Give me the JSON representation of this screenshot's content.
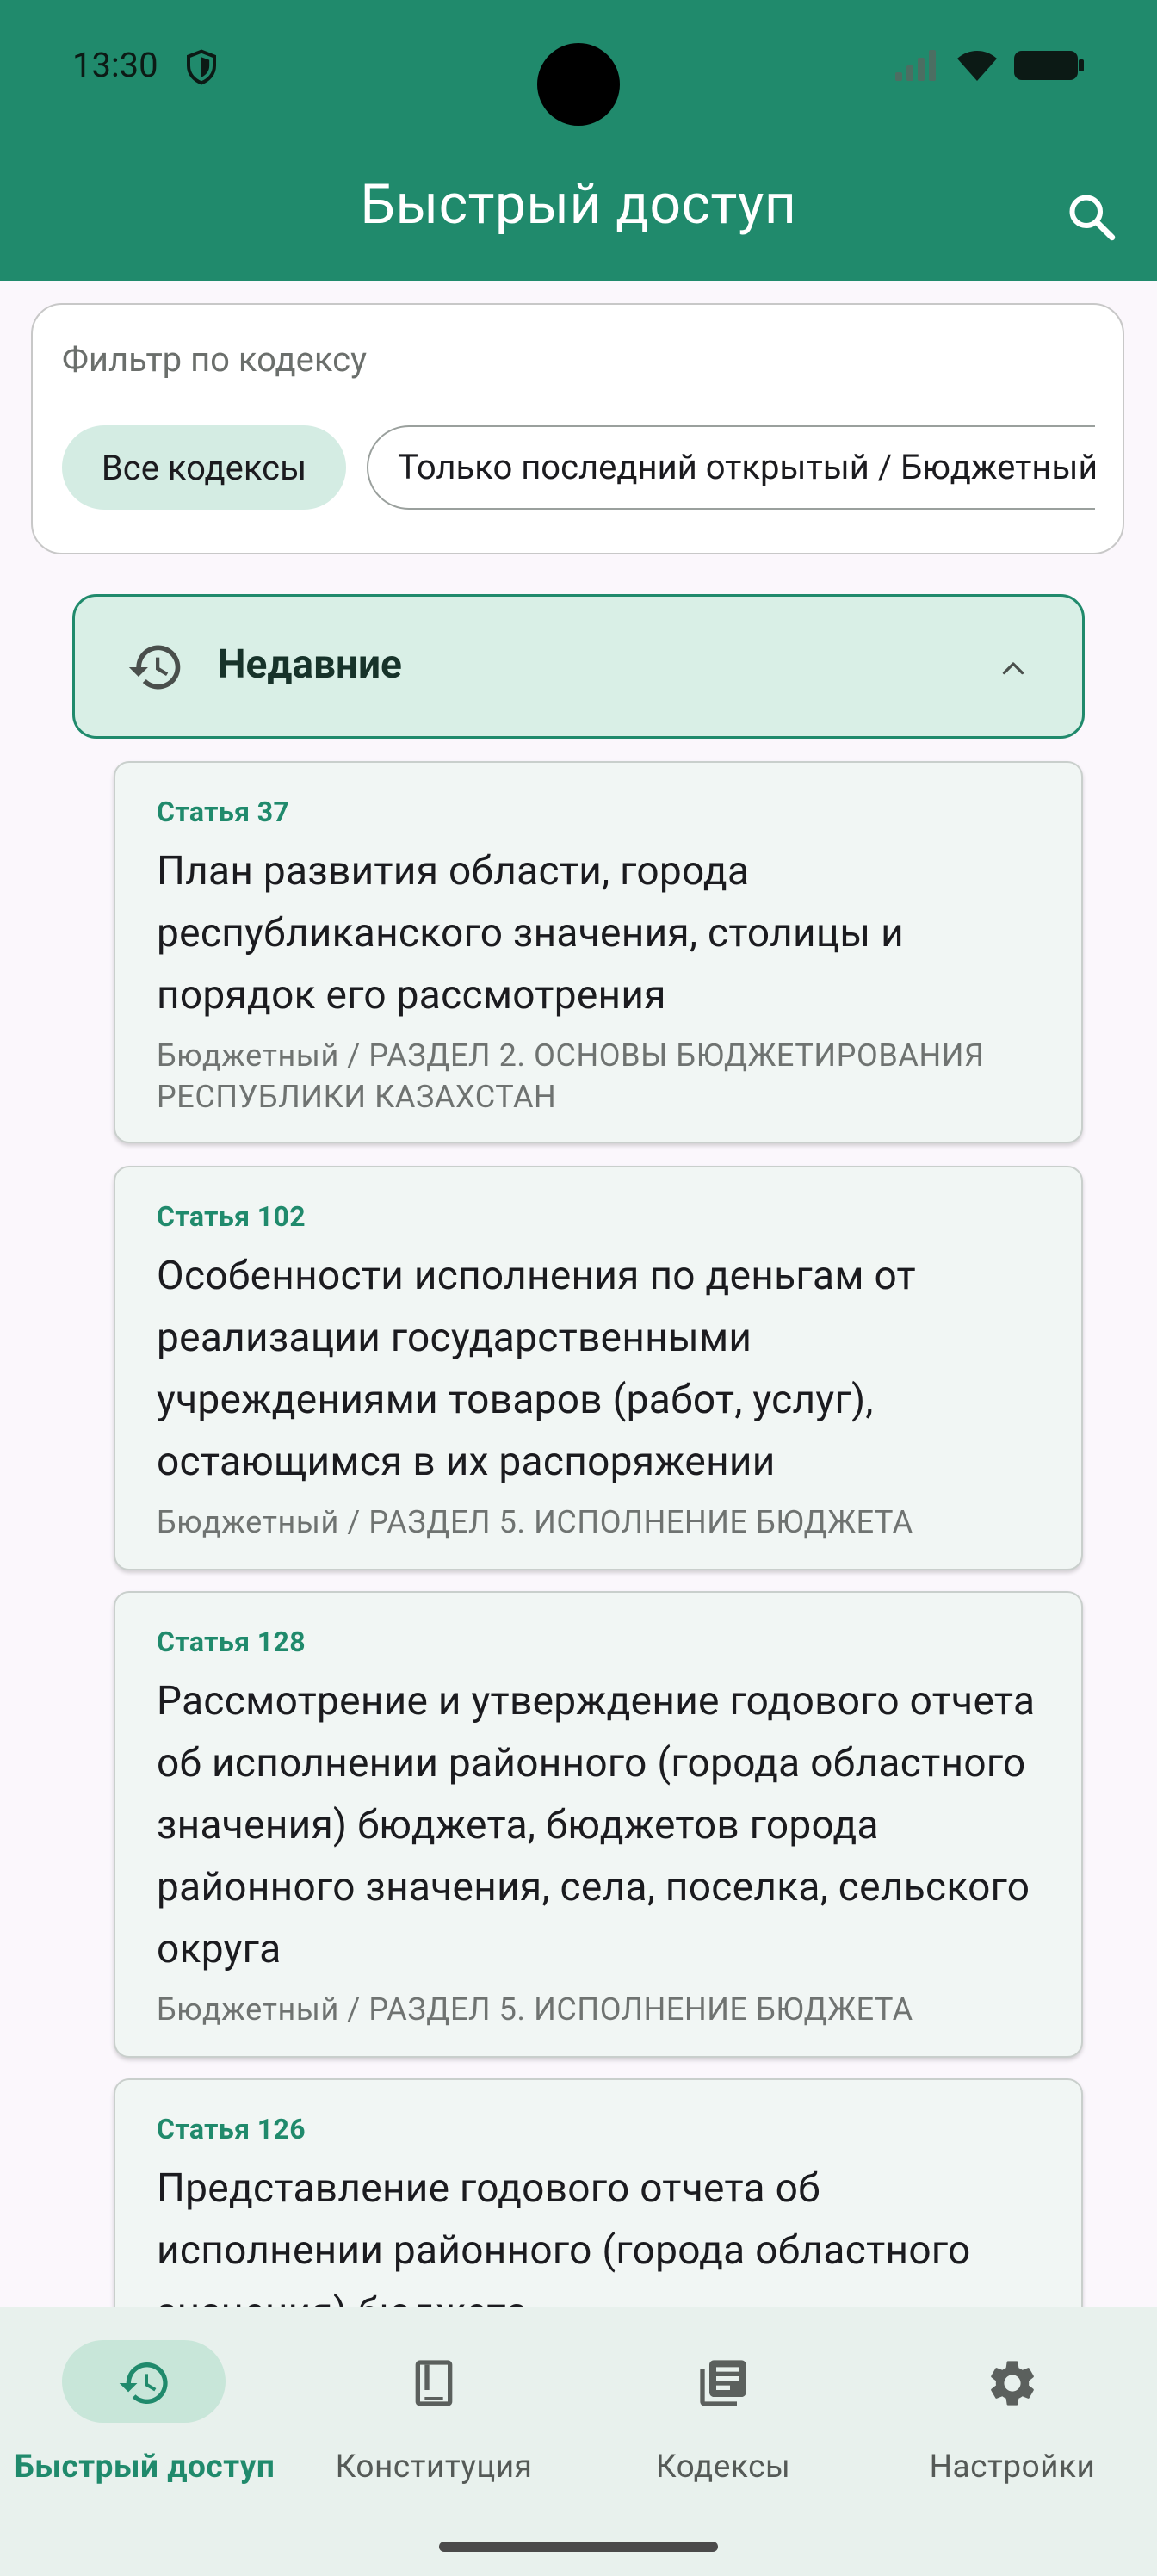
{
  "status": {
    "time": "13:30"
  },
  "header": {
    "title": "Быстрый доступ",
    "search_icon": "search-icon"
  },
  "filter": {
    "label": "Фильтр по кодексу",
    "chips": [
      "Все кодексы",
      "Только последний открытый / Бюджетный"
    ],
    "selected": "Все кодексы"
  },
  "section": {
    "title": "Недавние",
    "expanded": true
  },
  "articles": [
    {
      "number": "Статья 37",
      "title": "План развития области, города республиканского значения, столицы и порядок его рассмотрения",
      "path": "Бюджетный / РАЗДЕЛ 2. ОСНОВЫ БЮДЖЕТИРОВАНИЯ РЕСПУБЛИКИ КАЗАХСТАН"
    },
    {
      "number": "Статья 102",
      "title": "Особенности исполнения по деньгам от реализации государственными учреждениями товаров (работ, услуг), остающимся в их распоряжении",
      "path": "Бюджетный / РАЗДЕЛ 5. ИСПОЛНЕНИЕ БЮДЖЕТА"
    },
    {
      "number": "Статья 128",
      "title": "Рассмотрение и утверждение годового отчета об исполнении районного (города областного значения) бюджета, бюджетов города районного значения, села, поселка, сельского округа",
      "path": "Бюджетный / РАЗДЕЛ 5. ИСПОЛНЕНИЕ БЮДЖЕТА"
    },
    {
      "number": "Статья 126",
      "title": "Представление годового отчета об исполнении районного (города областного значения) бюджета",
      "path": ""
    }
  ],
  "nav": [
    {
      "label": "Быстрый доступ",
      "icon": "history-icon",
      "active": true
    },
    {
      "label": "Конституция",
      "icon": "book-icon",
      "active": false
    },
    {
      "label": "Кодексы",
      "icon": "library-icon",
      "active": false
    },
    {
      "label": "Настройки",
      "icon": "gear-icon",
      "active": false
    }
  ],
  "colors": {
    "primary": "#208a6c",
    "chip_selected": "#d4ece3",
    "section_bg": "#d9efe6",
    "nav_bg": "#e8f1ed"
  }
}
